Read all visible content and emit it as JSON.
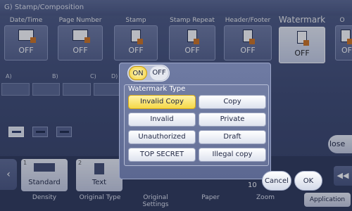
{
  "header": {
    "title": "G) Stamp/Composition"
  },
  "tabs": [
    {
      "label": "Date/Time",
      "value": "OFF",
      "icon": "date-time-icon",
      "active": false
    },
    {
      "label": "Page Number",
      "value": "OFF",
      "icon": "page-number-icon",
      "active": false
    },
    {
      "label": "Stamp",
      "value": "OFF",
      "icon": "stamp-icon",
      "active": false
    },
    {
      "label": "Stamp Repeat",
      "value": "OFF",
      "icon": "stamp-repeat-icon",
      "active": false
    },
    {
      "label": "Header/Footer",
      "value": "OFF",
      "icon": "header-footer-icon",
      "active": false
    },
    {
      "label": "Watermark",
      "value": "OFF",
      "icon": "watermark-icon",
      "active": true
    },
    {
      "label": "O",
      "value": "OF",
      "icon": "overlay-icon",
      "active": false
    }
  ],
  "row_labels": [
    "A)",
    "B)",
    "C)",
    "D)"
  ],
  "close_label": "lose",
  "bottom": {
    "cards": [
      {
        "num": "1",
        "label": "Standard",
        "caption": "Density"
      },
      {
        "num": "2",
        "label": "Text",
        "caption": "Original Type"
      }
    ],
    "labels": {
      "original_settings": "Original\nSettings",
      "paper": "Paper",
      "zoom": "Zoom"
    },
    "zoom_value": "10",
    "application": "Application",
    "rewind": "◀◀"
  },
  "dialog": {
    "on": "ON",
    "off": "OFF",
    "section_title": "Watermark Type",
    "options": [
      {
        "label": "Invalid Copy",
        "selected": true
      },
      {
        "label": "Copy",
        "selected": false
      },
      {
        "label": "Invalid",
        "selected": false
      },
      {
        "label": "Private",
        "selected": false
      },
      {
        "label": "Unauthorized",
        "selected": false
      },
      {
        "label": "Draft",
        "selected": false
      },
      {
        "label": "TOP SECRET",
        "selected": false
      },
      {
        "label": "Illegal copy",
        "selected": false
      }
    ],
    "cancel": "Cancel",
    "ok": "OK"
  },
  "colors": {
    "background": "#3b4870",
    "selected": "#f5d848",
    "button": "#e6eaf3"
  }
}
